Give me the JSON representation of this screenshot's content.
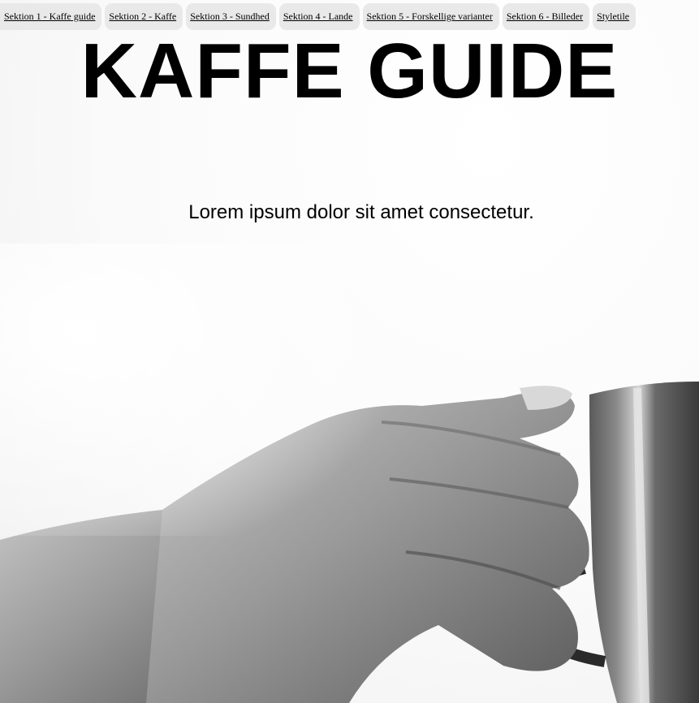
{
  "nav": {
    "items": [
      {
        "label": "Sektion 1 - Kaffe guide"
      },
      {
        "label": "Sektion 2 - Kaffe"
      },
      {
        "label": "Sektion 3 - Sundhed"
      },
      {
        "label": "Sektion 4 - Lande"
      },
      {
        "label": "Sektion 5 - Forskellige varianter"
      },
      {
        "label": "Sektion 6 - Billeder"
      },
      {
        "label": "Styletile"
      }
    ]
  },
  "hero": {
    "title": "KAFFE GUIDE",
    "tagline": "Lorem ipsum dolor sit amet consectetur."
  },
  "colors": {
    "nav_background": "#e9e9e9",
    "text": "#000000",
    "page_background": "#ffffff"
  }
}
